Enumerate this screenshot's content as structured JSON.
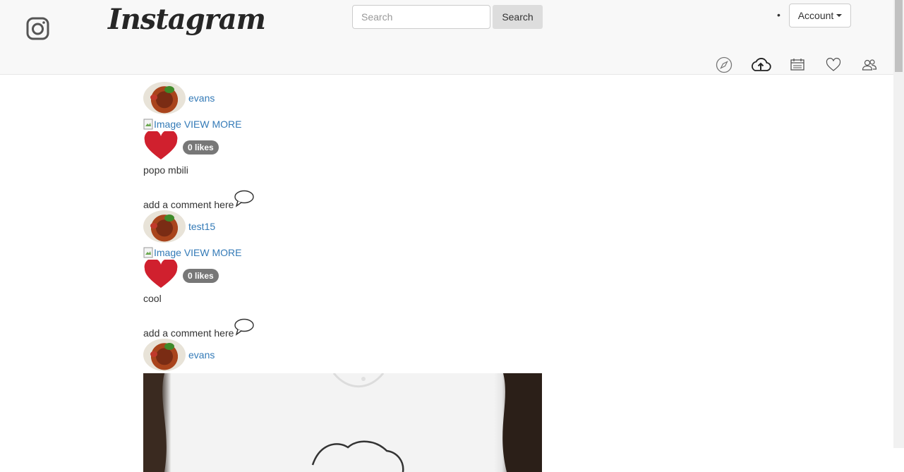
{
  "header": {
    "brand": "Instagram",
    "search": {
      "placeholder": "Search",
      "button_label": "Search"
    },
    "account_label": "Account",
    "bullet": "•"
  },
  "posts": [
    {
      "username": "evans",
      "image_alt": "Image",
      "view_more": "VIEW MORE",
      "likes": "0 likes",
      "caption": "popo mbili",
      "comment_prompt": "add a comment here"
    },
    {
      "username": "test15",
      "image_alt": "Image",
      "view_more": "VIEW MORE",
      "likes": "0 likes",
      "caption": "cool",
      "comment_prompt": "add a comment here"
    },
    {
      "username": "evans"
    }
  ],
  "colors": {
    "link": "#337ab7",
    "heart": "#d0202e",
    "badge": "#777777",
    "navbar_bg": "#f8f8f8"
  }
}
